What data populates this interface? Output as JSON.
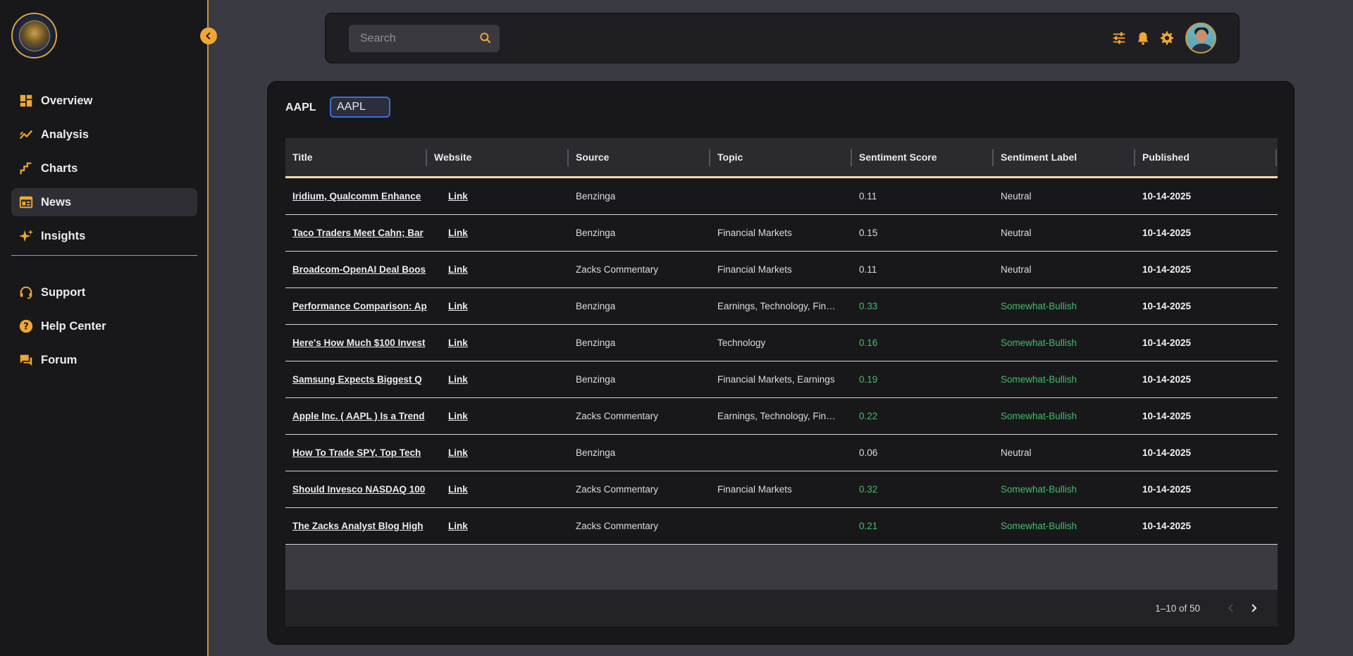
{
  "sidebar": {
    "items": [
      {
        "label": "Overview",
        "icon": "dashboard-icon"
      },
      {
        "label": "Analysis",
        "icon": "trend-line-icon"
      },
      {
        "label": "Charts",
        "icon": "bar-chart-icon"
      },
      {
        "label": "News",
        "icon": "newspaper-icon"
      },
      {
        "label": "Insights",
        "icon": "sparkle-icon"
      }
    ],
    "support_items": [
      {
        "label": "Support",
        "icon": "headset-icon"
      },
      {
        "label": "Help Center",
        "icon": "help-icon"
      },
      {
        "label": "Forum",
        "icon": "forum-icon"
      }
    ],
    "active": "News"
  },
  "topbar": {
    "search_placeholder": "Search",
    "icons": [
      "filter-sliders-icon",
      "bell-icon",
      "gear-icon",
      "avatar"
    ]
  },
  "news": {
    "ticker_label": "AAPL",
    "ticker_input_value": "AAPL",
    "columns": [
      "Title",
      "Website",
      "Source",
      "Topic",
      "Sentiment Score",
      "Sentiment Label",
      "Published"
    ],
    "rows": [
      {
        "title": "Iridium, Qualcomm Enhance",
        "website": "Link",
        "source": "Benzinga",
        "topic": "",
        "score": "0.11",
        "label": "Neutral",
        "published": "10-14-2025"
      },
      {
        "title": "Taco Traders Meet Cahn; Bar",
        "website": "Link",
        "source": "Benzinga",
        "topic": "Financial Markets",
        "score": "0.15",
        "label": "Neutral",
        "published": "10-14-2025"
      },
      {
        "title": "Broadcom-OpenAI Deal Boos",
        "website": "Link",
        "source": "Zacks Commentary",
        "topic": "Financial Markets",
        "score": "0.11",
        "label": "Neutral",
        "published": "10-14-2025"
      },
      {
        "title": "Performance Comparison: Ap",
        "website": "Link",
        "source": "Benzinga",
        "topic": "Earnings, Technology, Fin…",
        "score": "0.33",
        "label": "Somewhat-Bullish",
        "published": "10-14-2025"
      },
      {
        "title": "Here's How Much $100 Invest",
        "website": "Link",
        "source": "Benzinga",
        "topic": "Technology",
        "score": "0.16",
        "label": "Somewhat-Bullish",
        "published": "10-14-2025"
      },
      {
        "title": "Samsung Expects Biggest Q",
        "website": "Link",
        "source": "Benzinga",
        "topic": "Financial Markets, Earnings",
        "score": "0.19",
        "label": "Somewhat-Bullish",
        "published": "10-14-2025"
      },
      {
        "title": "Apple Inc. ( AAPL ) Is a Trend",
        "website": "Link",
        "source": "Zacks Commentary",
        "topic": "Earnings, Technology, Fin…",
        "score": "0.22",
        "label": "Somewhat-Bullish",
        "published": "10-14-2025"
      },
      {
        "title": "How To Trade SPY, Top Tech",
        "website": "Link",
        "source": "Benzinga",
        "topic": "",
        "score": "0.06",
        "label": "Neutral",
        "published": "10-14-2025"
      },
      {
        "title": "Should Invesco NASDAQ 100",
        "website": "Link",
        "source": "Zacks Commentary",
        "topic": "Financial Markets",
        "score": "0.32",
        "label": "Somewhat-Bullish",
        "published": "10-14-2025"
      },
      {
        "title": "The Zacks Analyst Blog High",
        "website": "Link",
        "source": "Zacks Commentary",
        "topic": "",
        "score": "0.21",
        "label": "Somewhat-Bullish",
        "published": "10-14-2025"
      }
    ],
    "pagination": "1–10 of 50"
  },
  "colors": {
    "accent": "#f0a733",
    "bullish": "#3fbf6b",
    "sidebar_bg": "#18181b",
    "page_bg": "#3a3a42"
  }
}
